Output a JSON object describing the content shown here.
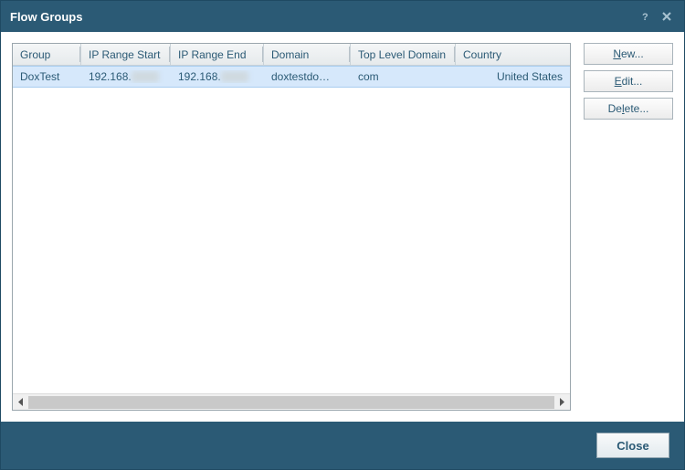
{
  "window": {
    "title": "Flow Groups"
  },
  "table": {
    "columns": {
      "group": "Group",
      "ip_start": "IP Range Start",
      "ip_end": "IP Range End",
      "domain": "Domain",
      "tld": "Top Level Domain",
      "country": "Country"
    },
    "rows": [
      {
        "group": "DoxTest",
        "ip_start_prefix": "192.168.",
        "ip_start_hidden": "xxx",
        "ip_end_prefix": "192.168.",
        "ip_end_hidden": "xxx",
        "domain": "doxtestdo…",
        "tld": "com",
        "country": "United States",
        "selected": true
      }
    ]
  },
  "side_buttons": {
    "new_u": "N",
    "new_rest": "ew...",
    "edit_u": "E",
    "edit_rest": "dit...",
    "delete_pre": "De",
    "delete_u": "l",
    "delete_rest": "ete..."
  },
  "footer": {
    "close": "Close"
  }
}
